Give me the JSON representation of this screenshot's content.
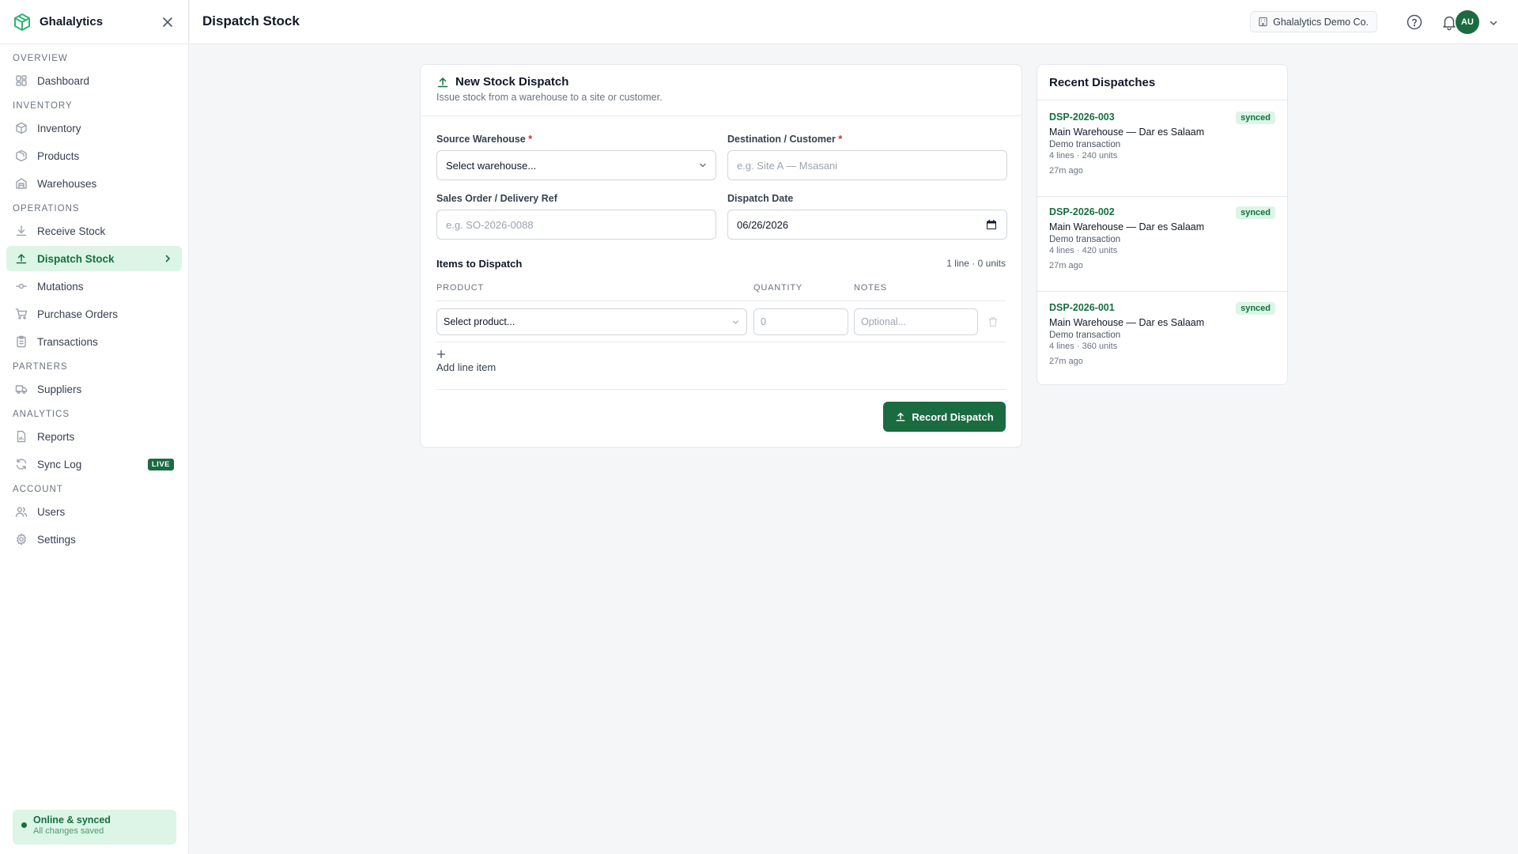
{
  "app": {
    "name": "Ghalalytics"
  },
  "sidebar": {
    "sections": [
      {
        "label": "OVERVIEW",
        "items": [
          {
            "label": "Dashboard",
            "icon": "dashboard-icon"
          }
        ]
      },
      {
        "label": "INVENTORY",
        "items": [
          {
            "label": "Inventory",
            "icon": "box-icon"
          },
          {
            "label": "Products",
            "icon": "products-icon"
          },
          {
            "label": "Warehouses",
            "icon": "warehouse-icon"
          }
        ]
      },
      {
        "label": "OPERATIONS",
        "items": [
          {
            "label": "Receive Stock",
            "icon": "download-icon"
          },
          {
            "label": "Dispatch Stock",
            "icon": "upload-icon",
            "active": true
          },
          {
            "label": "Mutations",
            "icon": "git-commit-icon"
          },
          {
            "label": "Purchase Orders",
            "icon": "cart-icon"
          },
          {
            "label": "Transactions",
            "icon": "clipboard-icon"
          }
        ]
      },
      {
        "label": "PARTNERS",
        "items": [
          {
            "label": "Suppliers",
            "icon": "truck-icon"
          }
        ]
      },
      {
        "label": "ANALYTICS",
        "items": [
          {
            "label": "Reports",
            "icon": "file-chart-icon"
          },
          {
            "label": "Sync Log",
            "icon": "refresh-icon",
            "badge": "LIVE"
          }
        ]
      },
      {
        "label": "ACCOUNT",
        "items": [
          {
            "label": "Users",
            "icon": "users-icon"
          },
          {
            "label": "Settings",
            "icon": "gear-icon"
          }
        ]
      }
    ],
    "status": {
      "title": "Online & synced",
      "subtitle": "All changes saved"
    }
  },
  "header": {
    "title": "Dispatch Stock",
    "company": "Ghalalytics Demo Co.",
    "avatar": "AU"
  },
  "form": {
    "title": "New Stock Dispatch",
    "subtitle": "Issue stock from a warehouse to a site or customer.",
    "source_label": "Source Warehouse",
    "source_value": "Select warehouse...",
    "dest_label": "Destination / Customer",
    "dest_placeholder": "e.g. Site A — Msasani",
    "ref_label": "Sales Order / Delivery Ref",
    "ref_placeholder": "e.g. SO-2026-0088",
    "date_label": "Dispatch Date",
    "date_value": "06/26/2026",
    "required_mark": "*",
    "items_title": "Items to Dispatch",
    "items_count": "1 line · 0 units",
    "columns": [
      "PRODUCT",
      "QUANTITY",
      "NOTES"
    ],
    "row": {
      "product": "Select product...",
      "quantity_placeholder": "0",
      "notes_placeholder": "Optional..."
    },
    "add_line": "Add line item",
    "submit": "Record Dispatch"
  },
  "recent": {
    "title": "Recent Dispatches",
    "items": [
      {
        "id": "DSP-2026-003",
        "status": "synced",
        "warehouse": "Main Warehouse — Dar es Salaam",
        "note": "Demo transaction",
        "lines": "4 lines · 240 units",
        "time": "27m ago"
      },
      {
        "id": "DSP-2026-002",
        "status": "synced",
        "warehouse": "Main Warehouse — Dar es Salaam",
        "note": "Demo transaction",
        "lines": "4 lines · 420 units",
        "time": "27m ago"
      },
      {
        "id": "DSP-2026-001",
        "status": "synced",
        "warehouse": "Main Warehouse — Dar es Salaam",
        "note": "Demo transaction",
        "lines": "4 lines · 360 units",
        "time": "27m ago"
      }
    ]
  },
  "colors": {
    "accent": "#1b6b41",
    "accent_light": "#dcf5e6",
    "required": "#dc2626"
  }
}
